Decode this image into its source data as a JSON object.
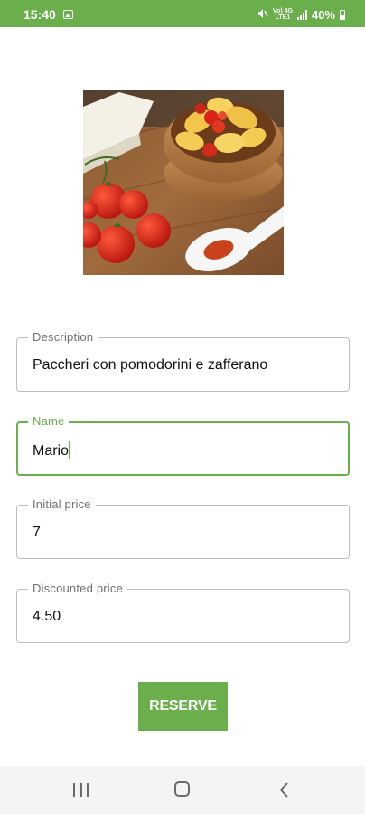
{
  "theme": {
    "accent": "#6aaf4b"
  },
  "status_bar": {
    "time": "15:40",
    "network": "Vo) 4G\nLTE1",
    "battery": "40%",
    "icons": [
      "gallery-icon",
      "mute-icon",
      "network-icon",
      "signal-icon",
      "battery-icon"
    ]
  },
  "dish": {
    "image_icon": "pasta-dish-photo"
  },
  "form": {
    "description": {
      "label": "Description",
      "value": "Paccheri con pomodorini e zafferano"
    },
    "name": {
      "label": "Name",
      "value": "Mario"
    },
    "initial_price": {
      "label": "Initial price",
      "value": "7"
    },
    "discounted_price": {
      "label": "Discounted price",
      "value": "4.50"
    }
  },
  "actions": {
    "reserve_label": "RESERVE"
  },
  "nav_bar": {
    "icons": [
      "recents-icon",
      "home-icon",
      "back-icon"
    ]
  }
}
